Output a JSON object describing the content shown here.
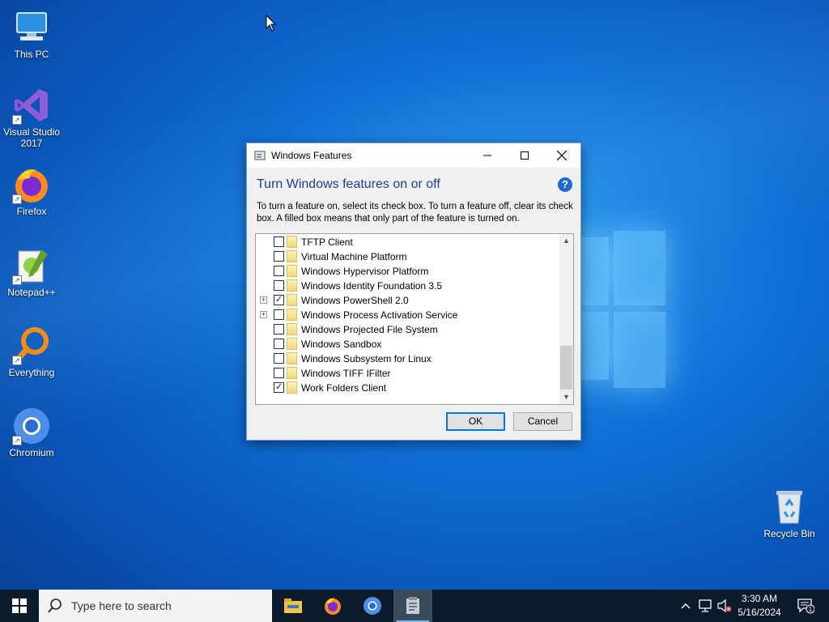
{
  "desktop": {
    "icons": [
      {
        "label": "This PC",
        "icon": "computer-icon"
      },
      {
        "label": "Visual Studio 2017",
        "icon": "visual-studio-icon"
      },
      {
        "label": "Firefox",
        "icon": "firefox-icon"
      },
      {
        "label": "Notepad++",
        "icon": "notepadpp-icon"
      },
      {
        "label": "Everything",
        "icon": "everything-search-icon"
      },
      {
        "label": "Chromium",
        "icon": "chromium-icon"
      },
      {
        "label": "Recycle Bin",
        "icon": "recycle-bin-icon"
      }
    ]
  },
  "dialog": {
    "title": "Windows Features",
    "heading": "Turn Windows features on or off",
    "help": "?",
    "description": "To turn a feature on, select its check box. To turn a feature off, clear its check box. A filled box means that only part of the feature is turned on.",
    "features": [
      {
        "label": "TFTP Client",
        "checked": false,
        "expandable": false
      },
      {
        "label": "Virtual Machine Platform",
        "checked": false,
        "expandable": false
      },
      {
        "label": "Windows Hypervisor Platform",
        "checked": false,
        "expandable": false
      },
      {
        "label": "Windows Identity Foundation 3.5",
        "checked": false,
        "expandable": false
      },
      {
        "label": "Windows PowerShell 2.0",
        "checked": true,
        "expandable": true
      },
      {
        "label": "Windows Process Activation Service",
        "checked": false,
        "expandable": true
      },
      {
        "label": "Windows Projected File System",
        "checked": false,
        "expandable": false
      },
      {
        "label": "Windows Sandbox",
        "checked": false,
        "expandable": false
      },
      {
        "label": "Windows Subsystem for Linux",
        "checked": false,
        "expandable": false
      },
      {
        "label": "Windows TIFF IFilter",
        "checked": false,
        "expandable": false
      },
      {
        "label": "Work Folders Client",
        "checked": true,
        "expandable": false
      }
    ],
    "ok_label": "OK",
    "cancel_label": "Cancel"
  },
  "taskbar": {
    "search_placeholder": "Type here to search",
    "apps": [
      "file-explorer-icon",
      "firefox-icon",
      "chromium-icon",
      "windows-features-icon"
    ],
    "clock_time": "3:30 AM",
    "clock_date": "5/16/2024",
    "notification_count": "1"
  },
  "colors": {
    "accent": "#0078d7",
    "heading": "#1e3f8f",
    "taskbar": "#0b1a2c"
  }
}
